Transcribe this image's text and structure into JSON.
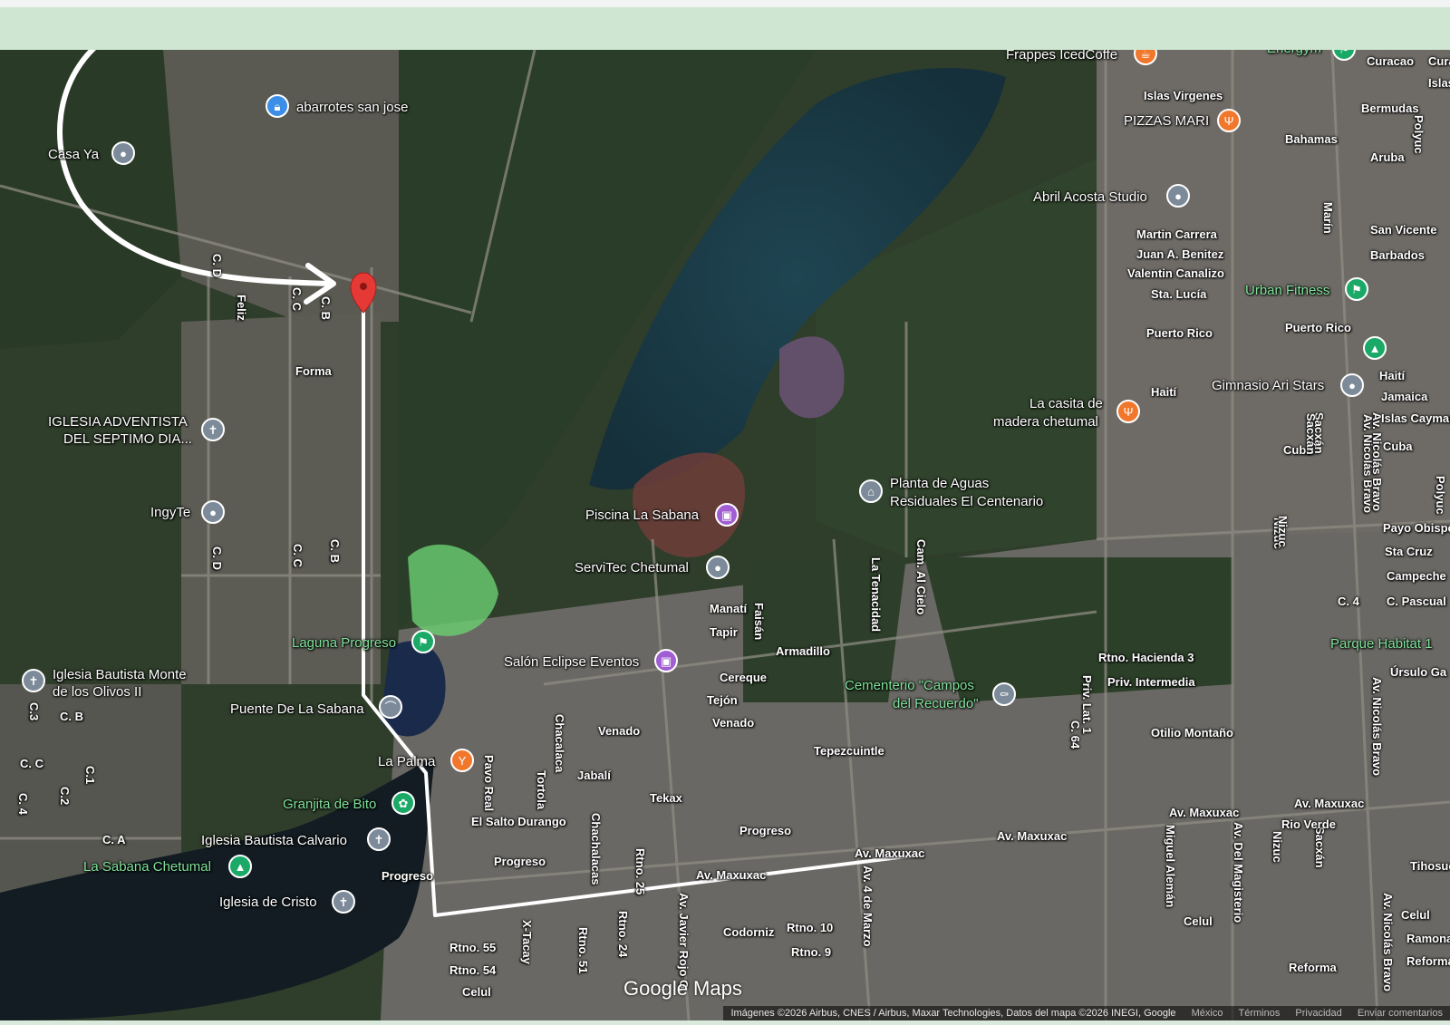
{
  "map": {
    "brand": "Google Maps",
    "attribution": "Imágenes ©2026 Airbus, CNES / Airbus, Maxar Technologies, Datos del mapa ©2026 INEGI, Google",
    "footer_links": [
      "México",
      "Términos",
      "Privacidad",
      "Enviar comentarios"
    ],
    "places": [
      {
        "name": "abarrotes san jose",
        "icon": "bag-icon"
      },
      {
        "name": "Casa Ya",
        "icon": "place-icon"
      },
      {
        "name": "IGLESIA ADVENTISTA",
        "icon": "church-icon"
      },
      {
        "name": "DEL SEPTIMO DIA...",
        "icon": ""
      },
      {
        "name": "IngyTe",
        "icon": "place-icon"
      },
      {
        "name": "Laguna Progreso",
        "icon": "park-icon"
      },
      {
        "name": "Iglesia Bautista Monte",
        "icon": "church-icon"
      },
      {
        "name": "de los Olivos II",
        "icon": ""
      },
      {
        "name": "Puente De La Sabana",
        "icon": "bridge-icon"
      },
      {
        "name": "La Palma",
        "icon": "bar-icon"
      },
      {
        "name": "Granjita de Bito",
        "icon": "flower-icon"
      },
      {
        "name": "Iglesia Bautista Calvario",
        "icon": "church-icon"
      },
      {
        "name": "La Sabana Chetumal",
        "icon": "tree-icon"
      },
      {
        "name": "Iglesia de Cristo",
        "icon": "church-icon"
      },
      {
        "name": "Piscina La Sabana",
        "icon": "event-icon"
      },
      {
        "name": "ServiTec Chetumal",
        "icon": "place-icon"
      },
      {
        "name": "Salón Eclipse Eventos",
        "icon": "event-icon"
      },
      {
        "name": "Planta de Aguas",
        "icon": "building-icon"
      },
      {
        "name": "Residuales El Centenario",
        "icon": ""
      },
      {
        "name": "La casita de",
        "icon": "restaurant-icon"
      },
      {
        "name": "madera chetumal",
        "icon": ""
      },
      {
        "name": "Frappes IcedCoffe",
        "icon": "cafe-icon"
      },
      {
        "name": "PIZZAS MARI",
        "icon": "restaurant-icon"
      },
      {
        "name": "Abril Acosta Studio",
        "icon": "place-icon"
      },
      {
        "name": "Urban Fitness",
        "icon": "fitness-icon"
      },
      {
        "name": "Gimnasio Ari Stars",
        "icon": "place-icon"
      },
      {
        "name": "Cementerio \"Campos",
        "icon": "cemetery-icon"
      },
      {
        "name": "del Recuerdo\"",
        "icon": ""
      },
      {
        "name": "Parque Habitat 1",
        "icon": ""
      },
      {
        "name": "Energym",
        "icon": "fitness-icon"
      }
    ],
    "streets": [
      "Forma",
      "Feliz",
      "C. D",
      "C. C",
      "C. B",
      "C. A",
      "C.3",
      "C. B",
      "C. C",
      "C.1",
      "C.2",
      "C. 4",
      "C. A",
      "C. D",
      "C. C",
      "C. B",
      "Pavo Real",
      "Tortola",
      "Chacalaca",
      "Jabalí",
      "Venado",
      "Tekax",
      "El Salto Durango",
      "Progreso",
      "Chachalacas",
      "Progreso",
      "Rtno. 25",
      "Rtno. 24",
      "Av. Javier Rojo G.",
      "Rtno. 55",
      "Rtno. 54",
      "Celul",
      "X-Tacay",
      "Rtno. 51",
      "Codorniz",
      "Rtno. 10",
      "Rtno. 9",
      "Faisán",
      "Manatí",
      "Tapir",
      "Armadillo",
      "Cereque",
      "Tejón",
      "Venado",
      "Tepezcuintle",
      "Progreso",
      "Av. Maxuxac",
      "Av. Maxuxac",
      "Av. Maxuxac",
      "Av. 4 de Marzo",
      "La Tenacidad",
      "Cam. Al Cielo",
      "Rtno. Hacienda 3",
      "Priv. Intermedia",
      "Priv. Lat. 1",
      "C. 64",
      "Otilio Montaño",
      "Av. Maxuxac",
      "Miguel Alemán",
      "Av. Del Magisterio",
      "Nizuc",
      "Sacxán",
      "Celul",
      "Av. Maxuxac",
      "Rio Verde",
      "Nizuc",
      "Sacxán",
      "Reforma",
      "Av. Nicolás Bravo",
      "Islas Virgenes",
      "Bahamas",
      "Marín",
      "Martin Carrera",
      "Juan A. Benitez",
      "Valentin Canalizo",
      "Sta. Lucía",
      "Puerto Rico",
      "Puerto Rico",
      "Haití",
      "Cuba",
      "Sacxán",
      "Nizuc",
      "Av. Nicolás Bravo",
      "Curacao",
      "Bermudas",
      "Aruba",
      "Polyuc",
      "San Vicente",
      "Barbados",
      "Haití",
      "Jamaica",
      "Islas Cayman",
      "Cuba",
      "Payo Obispo",
      "Sta Cruz",
      "Campeche",
      "C. 4",
      "C. Pascual",
      "Úrsulo Ga",
      "Av. Nicolás Bravo",
      "Celul",
      "Ramonal",
      "Reforma",
      "Tihosuco",
      "Av. Nicolás Bravo",
      "Cura",
      "Islas Vi",
      "Polyuc"
    ]
  }
}
